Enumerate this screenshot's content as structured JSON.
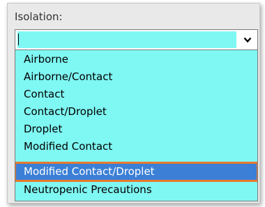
{
  "isolation": {
    "label": "Isolation:",
    "input_value": "",
    "dropdown_icon": "chevron-down-icon",
    "options": [
      "Airborne",
      "Airborne/Contact",
      "Contact",
      "Contact/Droplet",
      "Droplet",
      "Modified Contact",
      "Modified Contact/Droplet",
      "Neutropenic Precautions"
    ],
    "highlighted_option": "Modified Contact/Droplet"
  },
  "colors": {
    "field_background": "#7ff7f2",
    "selection": "#3b7fd6",
    "highlight_outline": "#e8792f"
  }
}
